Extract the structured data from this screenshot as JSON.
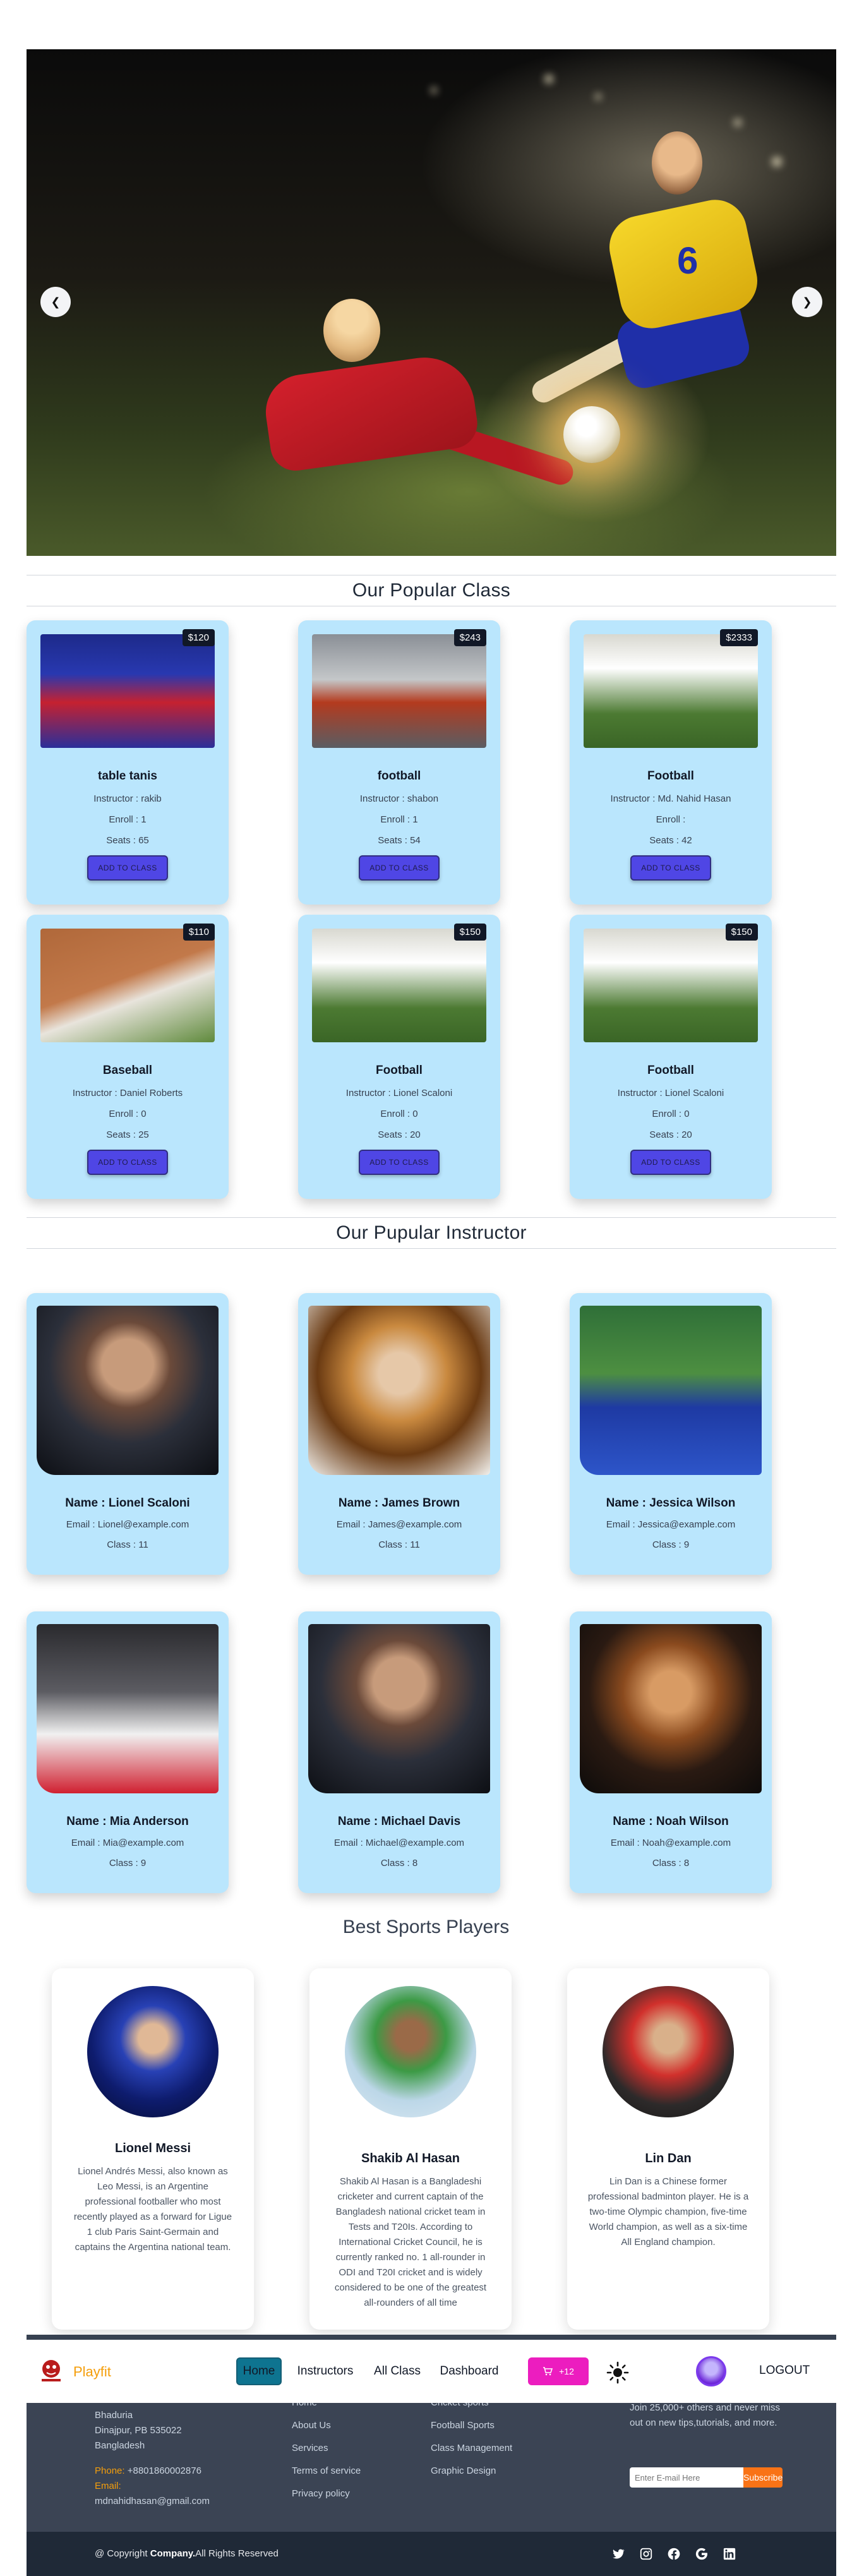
{
  "hero": {
    "jersey_number": "6"
  },
  "popular_class": {
    "title": "Our Popular Class",
    "button_label": "ADD TO CLASS",
    "items": [
      {
        "price": "$120",
        "name": "table tanis",
        "instructor": "Instructor : rakib",
        "enroll": "Enroll : 1",
        "seats": "Seats : 65"
      },
      {
        "price": "$243",
        "name": "football",
        "instructor": "Instructor : shabon",
        "enroll": "Enroll : 1",
        "seats": "Seats : 54"
      },
      {
        "price": "$2333",
        "name": "Football",
        "instructor": "Instructor : Md. Nahid Hasan",
        "enroll": "Enroll :",
        "seats": "Seats : 42"
      },
      {
        "price": "$110",
        "name": "Baseball",
        "instructor": "Instructor : Daniel Roberts",
        "enroll": "Enroll : 0",
        "seats": "Seats : 25"
      },
      {
        "price": "$150",
        "name": "Football",
        "instructor": "Instructor : Lionel Scaloni",
        "enroll": "Enroll : 0",
        "seats": "Seats : 20"
      },
      {
        "price": "$150",
        "name": "Football",
        "instructor": "Instructor : Lionel Scaloni",
        "enroll": "Enroll : 0",
        "seats": "Seats : 20"
      }
    ]
  },
  "popular_instructor": {
    "title": "Our Pupular Instructor",
    "items": [
      {
        "name": "Name : Lionel Scaloni",
        "email": "Email : Lionel@example.com",
        "class": "Class : 11"
      },
      {
        "name": "Name : James Brown",
        "email": "Email : James@example.com",
        "class": "Class : 11"
      },
      {
        "name": "Name : Jessica Wilson",
        "email": "Email : Jessica@example.com",
        "class": "Class : 9"
      },
      {
        "name": "Name : Mia Anderson",
        "email": "Email : Mia@example.com",
        "class": "Class : 9"
      },
      {
        "name": "Name : Michael Davis",
        "email": "Email : Michael@example.com",
        "class": "Class : 8"
      },
      {
        "name": "Name : Noah Wilson",
        "email": "Email : Noah@example.com",
        "class": "Class : 8"
      }
    ]
  },
  "best_players": {
    "title": "Best Sports Players",
    "items": [
      {
        "name": "Lionel Messi",
        "desc": "Lionel Andrés Messi, also known as Leo Messi, is an Argentine professional footballer who most recently played as a forward for Ligue 1 club Paris Saint-Germain and captains the Argentina national team."
      },
      {
        "name": "Shakib Al Hasan",
        "desc": "Shakib Al Hasan is a Bangladeshi cricketer and current captain of the Bangladesh national cricket team in Tests and T20Is. According to International Cricket Council, he is currently ranked no. 1 all-rounder in ODI and T20I cricket and is widely considered to be one of the greatest all-rounders of all time"
      },
      {
        "name": "Lin Dan",
        "desc": "Lin Dan is a Chinese former professional badminton player. He is a two-time Olympic champion, five-time World champion, as well as a six-time All England champion."
      }
    ]
  },
  "navbar": {
    "brand": "Playfit",
    "items": [
      "Home",
      "Instructors",
      "All Class",
      "Dashboard"
    ],
    "cart_count": "+12",
    "logout": "LOGOUT"
  },
  "footer": {
    "address": [
      "Bhaduria",
      "Dinajpur, PB 535022",
      "Bangladesh"
    ],
    "phone_label": "Phone:",
    "phone": "+8801860002876",
    "email_label": "Email:",
    "email": "mdnahidhasan@gmail.com",
    "links_col1": [
      "Home",
      "About Us",
      "Services",
      "Terms of service",
      "Privacy policy"
    ],
    "links_col2": [
      "Cricket sports",
      "Football Sports",
      "Class Management",
      "Graphic Design"
    ],
    "newsletter_text": "Join 25,000+ others and never miss out on new tips,tutorials, and more.",
    "email_placeholder": "Enter E-mail Here",
    "subscribe_label": "Subscribe",
    "copyright_prefix": "@ Copyright ",
    "copyright_company": "Company.",
    "copyright_suffix": "All Rights Reserved",
    "social_icons": [
      "twitter-icon",
      "instagram-icon",
      "facebook-icon",
      "google-icon",
      "linkedin-icon"
    ]
  }
}
